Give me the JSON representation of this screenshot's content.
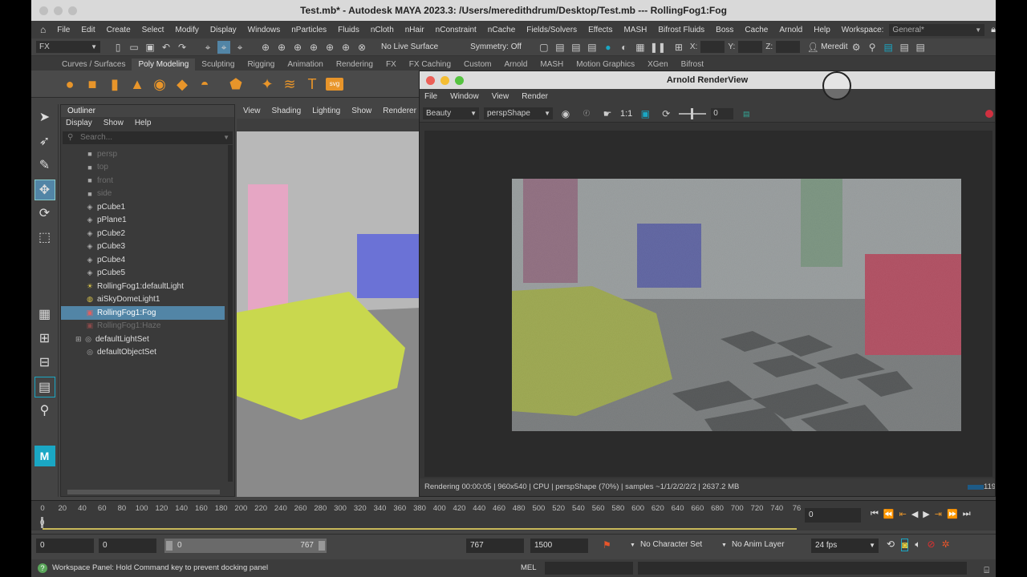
{
  "window": {
    "title": "Test.mb* - Autodesk MAYA 2023.3: /Users/meredithdrum/Desktop/Test.mb  ---  RollingFog1:Fog"
  },
  "menubar": {
    "items": [
      "File",
      "Edit",
      "Create",
      "Select",
      "Modify",
      "Display",
      "Windows",
      "nParticles",
      "Fluids",
      "nCloth",
      "nHair",
      "nConstraint",
      "nCache",
      "Fields/Solvers",
      "Effects",
      "MASH",
      "Bifrost Fluids",
      "Boss",
      "Cache",
      "Arnold",
      "Help"
    ],
    "workspace_label": "Workspace:",
    "workspace_value": "General*"
  },
  "statusline": {
    "menuset": "FX",
    "live_surface": "No Live Surface",
    "symmetry": "Symmetry: Off",
    "x_label": "X:",
    "y_label": "Y:",
    "z_label": "Z:",
    "user": "Meredith"
  },
  "shelf": {
    "tabs": [
      "Curves / Surfaces",
      "Poly Modeling",
      "Sculpting",
      "Rigging",
      "Animation",
      "Rendering",
      "FX",
      "FX Caching",
      "Custom",
      "Arnold",
      "MASH",
      "Motion Graphics",
      "XGen",
      "Bifrost"
    ],
    "active_tab": "Poly Modeling",
    "svg_label": "svg"
  },
  "outliner": {
    "title": "Outliner",
    "menu": [
      "Display",
      "Show",
      "Help"
    ],
    "search_placeholder": "Search...",
    "items": [
      {
        "label": "persp",
        "dim": true,
        "icon": "camera-icon"
      },
      {
        "label": "top",
        "dim": true,
        "icon": "camera-icon"
      },
      {
        "label": "front",
        "dim": true,
        "icon": "camera-icon"
      },
      {
        "label": "side",
        "dim": true,
        "icon": "camera-icon"
      },
      {
        "label": "pCube1",
        "icon": "mesh-icon"
      },
      {
        "label": "pPlane1",
        "icon": "mesh-icon"
      },
      {
        "label": "pCube2",
        "icon": "mesh-icon"
      },
      {
        "label": "pCube3",
        "icon": "mesh-icon"
      },
      {
        "label": "pCube4",
        "icon": "mesh-icon"
      },
      {
        "label": "pCube5",
        "icon": "mesh-icon"
      },
      {
        "label": "RollingFog1:defaultLight",
        "icon": "light-icon"
      },
      {
        "label": "aiSkyDomeLight1",
        "icon": "skydome-icon"
      },
      {
        "label": "RollingFog1:Fog",
        "selected": true,
        "icon": "fog-icon"
      },
      {
        "label": "RollingFog1:Haze",
        "dim": true,
        "icon": "fog-icon"
      },
      {
        "label": "defaultLightSet",
        "icon": "set-icon"
      },
      {
        "label": "defaultObjectSet",
        "icon": "set-icon"
      }
    ]
  },
  "viewport": {
    "menu": [
      "View",
      "Shading",
      "Lighting",
      "Show",
      "Renderer"
    ]
  },
  "renderview": {
    "title": "Arnold RenderView",
    "menu": [
      "File",
      "Window",
      "View",
      "Render"
    ],
    "aov": "Beauty",
    "camera": "perspShape",
    "ratio": "1:1",
    "exposure": "0",
    "status": "Rendering 00:00:05  |  960x540 | CPU | perspShape (70%) | samples ~1/1/2/2/2/2 | 2637.2 MB",
    "progress_text": "119"
  },
  "timeslider": {
    "ticks": [
      "0",
      "20",
      "40",
      "60",
      "80",
      "100",
      "120",
      "140",
      "160",
      "180",
      "200",
      "220",
      "240",
      "260",
      "280",
      "300",
      "320",
      "340",
      "360",
      "380",
      "400",
      "420",
      "440",
      "460",
      "480",
      "500",
      "520",
      "540",
      "560",
      "580",
      "600",
      "620",
      "640",
      "660",
      "680",
      "700",
      "720",
      "740",
      "76"
    ],
    "current_frame_marker": "0",
    "current_frame": "0"
  },
  "rangebar": {
    "start": "0",
    "anim_start": "0",
    "range_start": "0",
    "range_end": "767",
    "anim_end": "767",
    "end": "1500",
    "character_set": "No Character Set",
    "anim_layer": "No Anim Layer",
    "fps": "24 fps"
  },
  "helpline": {
    "message": "Workspace Panel: Hold Command key to prevent docking panel",
    "mel_label": "MEL"
  },
  "colors": {
    "selection": "#5285a6",
    "shelf_icon": "#e8952a",
    "maya_logo": "#1aa7c4"
  }
}
